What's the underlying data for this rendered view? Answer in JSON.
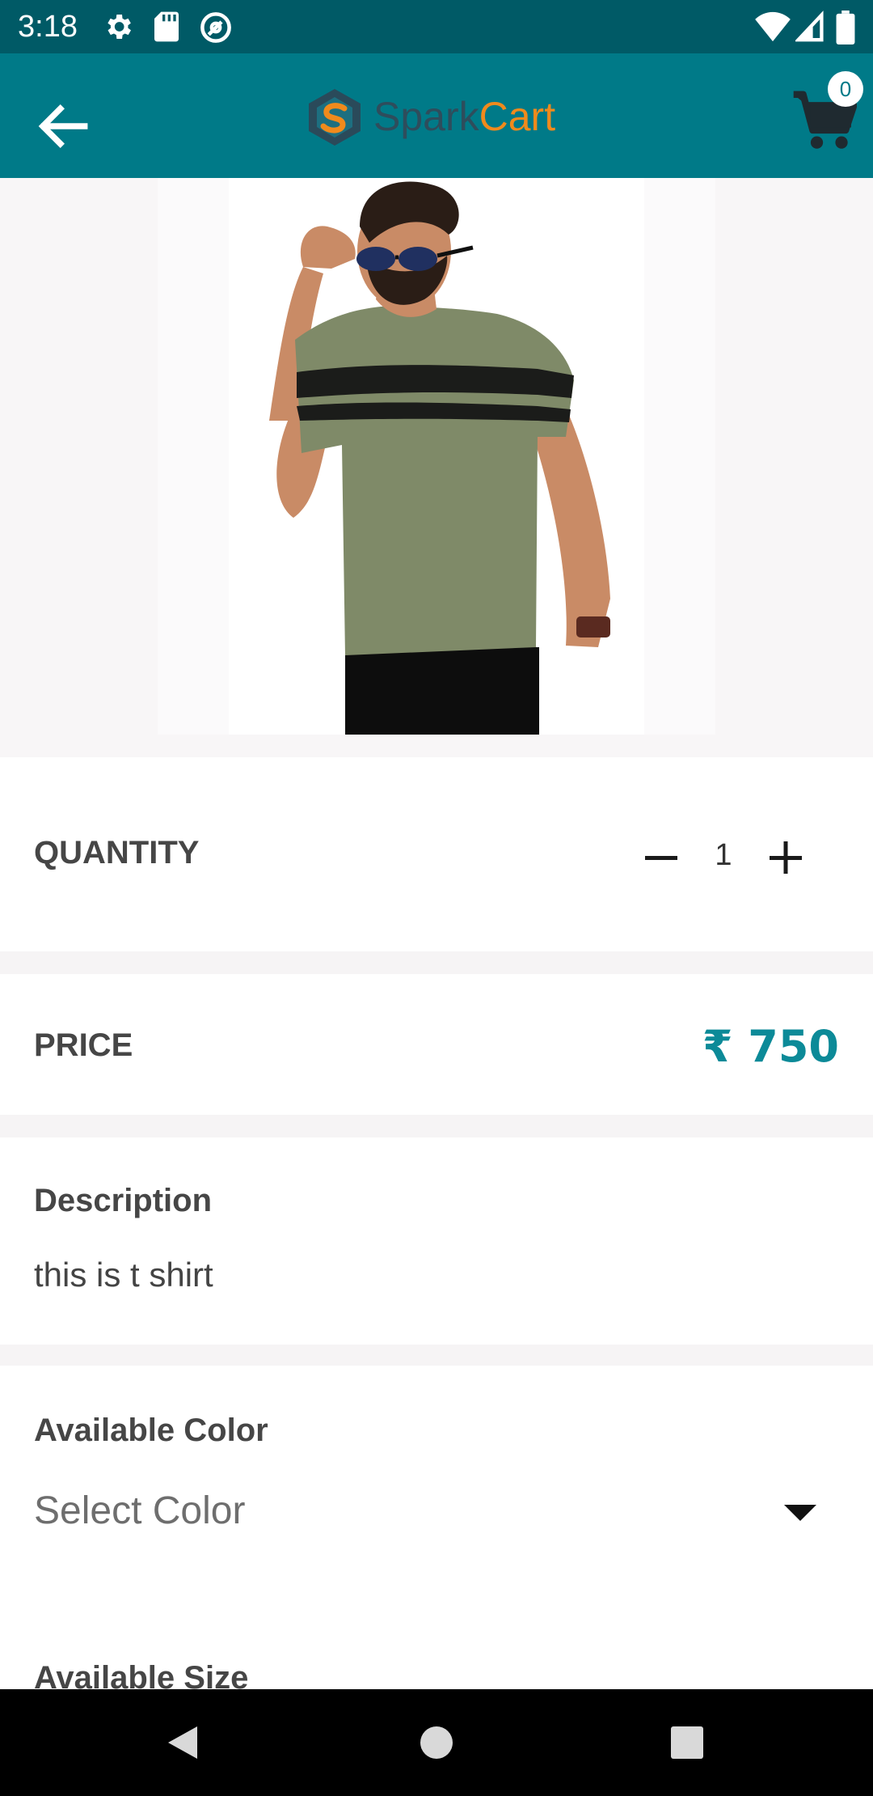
{
  "status_bar": {
    "time": "3:18",
    "icons": [
      "settings-icon",
      "sd-card-icon",
      "at-sign-icon",
      "wifi-icon",
      "cellular-signal-icon",
      "battery-icon"
    ]
  },
  "app_bar": {
    "logo_part1": "Spark",
    "logo_part2": "Cart",
    "cart_count": "0",
    "colors": {
      "background": "#007a88",
      "spark": "#2e4d5c",
      "cart": "#f08a1c"
    }
  },
  "product": {
    "image_alt": "product-image-man-in-olive-striped-t-shirt"
  },
  "quantity": {
    "label": "QUANTITY",
    "value": "1"
  },
  "price": {
    "label": "PRICE",
    "value": "₹ 750",
    "color": "#0c8a98"
  },
  "description": {
    "heading": "Description",
    "text": "this is t shirt"
  },
  "color_section": {
    "heading": "Available Color",
    "selected": "Select Color"
  },
  "size_section": {
    "heading": "Available Size"
  },
  "nav_bar": {
    "icons": [
      "back-triangle-icon",
      "home-circle-icon",
      "recents-square-icon"
    ]
  }
}
